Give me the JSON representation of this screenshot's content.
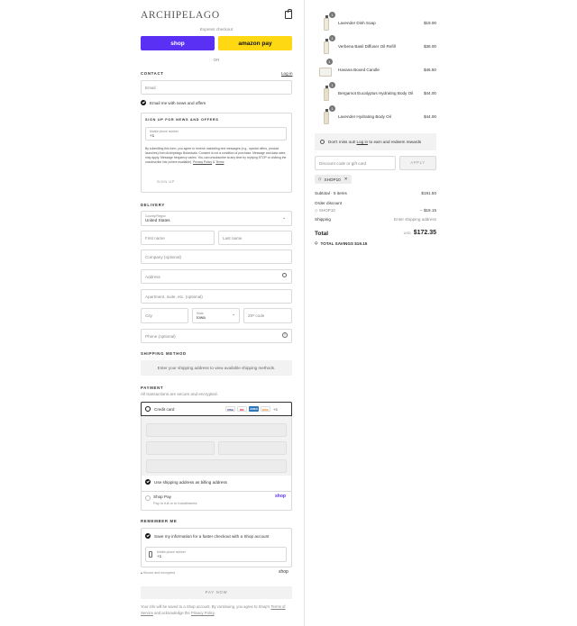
{
  "brand": {
    "logo_text": "ARCHIPELAGO"
  },
  "express": {
    "label": "Express checkout",
    "shop_label": "shop",
    "amazon_label": "amazon pay",
    "or_label": "OR"
  },
  "contact": {
    "title": "CONTACT",
    "login_link": "Log in",
    "email_placeholder": "Email",
    "news_label": "Email me with news and offers"
  },
  "sms": {
    "title": "SIGN UP FOR NEWS AND OFFERS",
    "phone_label": "Mobile phone number",
    "phone_value": "+1",
    "disclaimer": "By submitting this form, you agree to receive marketing text messages (e.g., special offers, product launches) from Archipelago Botanicals. Consent is not a condition of purchase. Message and data rates may apply. Message frequency varies. You can unsubscribe at any time by replying STOP or clicking the unsubscribe link (where available).",
    "privacy_link": "Privacy Policy",
    "and": "&",
    "terms_link": "Terms",
    "signup_button": "SIGN UP"
  },
  "delivery": {
    "title": "DELIVERY",
    "country_label": "Country/Region",
    "country_value": "United States",
    "first_name": "First name",
    "last_name": "Last name",
    "company": "Company (optional)",
    "address": "Address",
    "apartment": "Apartment, suite, etc. (optional)",
    "city": "City",
    "state_label": "State",
    "state_value": "Iowa",
    "zip": "ZIP code",
    "phone": "Phone (optional)"
  },
  "shipping_method": {
    "title": "SHIPPING METHOD",
    "message": "Enter your shipping address to view available shipping methods."
  },
  "payment": {
    "title": "PAYMENT",
    "subtitle": "All transactions are secure and encrypted.",
    "credit_card_label": "Credit card",
    "cards": [
      "VISA",
      "MC",
      "AMEX",
      "DISC"
    ],
    "more_cards": "+3",
    "billing_label": "Use shipping address as billing address",
    "shop_pay_label": "Shop Pay",
    "shop_pay_sub": "Pay in full or in installments",
    "shop_pay_logo": "shop"
  },
  "remember": {
    "title": "REMEMBER ME",
    "save_label": "Save my information for a faster checkout with a Shop account",
    "phone_label": "Mobile phone number",
    "phone_value": "+1",
    "secure_label": "Secure and encrypted",
    "shop_logo": "shop"
  },
  "pay_now": {
    "label": "PAY NOW"
  },
  "footer": {
    "text": "Your info will be saved to a Shop account. By continuing, you agree to Shop's",
    "terms": "Terms of Service",
    "mid": "and acknowledge the",
    "privacy": "Privacy Policy",
    "end": "."
  },
  "cart": {
    "items": [
      {
        "name": "Lavender Dish Soap",
        "price": "$19.00",
        "qty": "1"
      },
      {
        "name": "Verbena Basil Diffuser Oil Refill",
        "price": "$36.00",
        "qty": "1"
      },
      {
        "name": "Havana Boxed Candle",
        "price": "$46.50",
        "qty": "1"
      },
      {
        "name": "Bergamot Eucalyptus Hydrating Body Oil",
        "price": "$44.00",
        "qty": "1"
      },
      {
        "name": "Lavender Hydrating Body Oil",
        "price": "$44.00",
        "qty": "1"
      }
    ],
    "rewards_prefix": "Don't miss out!",
    "rewards_link": "Log in",
    "rewards_suffix": "to earn and redeem rewards",
    "discount_placeholder": "Discount code or gift card",
    "apply_label": "APPLY",
    "applied_code": "SHOP10",
    "subtotal_label": "Subtotal · 5 items",
    "subtotal_value": "$191.50",
    "order_discount_label": "Order discount",
    "discount_code": "SHOP10",
    "discount_value": "− $19.15",
    "shipping_label": "Shipping",
    "shipping_value": "Enter shipping address",
    "total_label": "Total",
    "currency": "USD",
    "total_value": "$172.35",
    "savings_label": "TOTAL SAVINGS",
    "savings_value": "$19.15"
  }
}
